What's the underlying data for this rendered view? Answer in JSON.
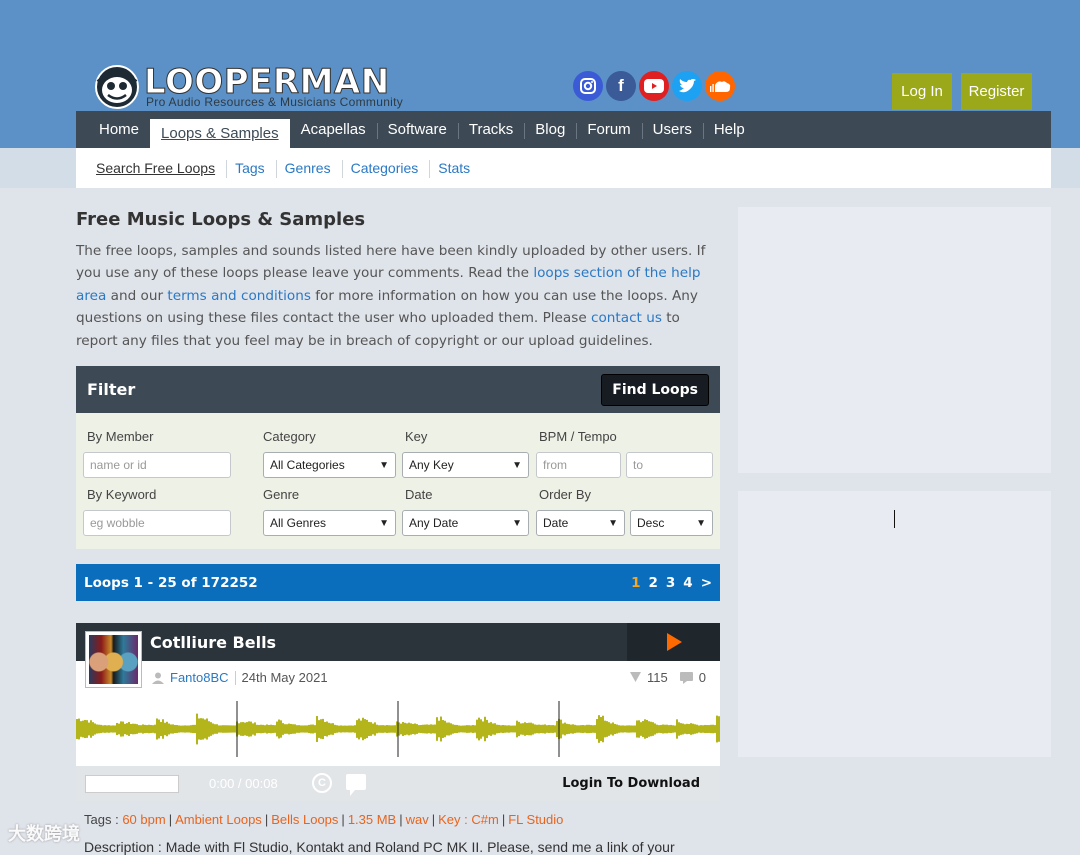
{
  "header": {
    "logo_text": "LOOPERMAN",
    "logo_sub": "Pro Audio Resources & Musicians Community",
    "login_label": "Log In",
    "register_label": "Register",
    "socials": [
      "instagram-icon",
      "facebook-icon",
      "youtube-icon",
      "twitter-icon",
      "soundcloud-icon"
    ]
  },
  "nav": {
    "items": [
      "Home",
      "Loops & Samples",
      "Acapellas",
      "Software",
      "Tracks",
      "Blog",
      "Forum",
      "Users",
      "Help"
    ],
    "active": "Loops & Samples"
  },
  "subnav": {
    "items": [
      "Search Free Loops",
      "Tags",
      "Genres",
      "Categories",
      "Stats"
    ]
  },
  "intro": {
    "title": "Free Music Loops & Samples",
    "p1": "The free loops, samples and sounds listed here have been kindly uploaded by other users. If you use any of these loops please leave your comments. Read the ",
    "link1": "loops section of the help area",
    "p2": " and our ",
    "link2": "terms and conditions",
    "p3": " for more information on how you can use the loops. Any questions on using these files contact the user who uploaded them. Please ",
    "link3": "contact us",
    "p4": " to report any files that you feel may be in breach of copyright or our upload guidelines."
  },
  "filter": {
    "title": "Filter",
    "find_label": "Find Loops",
    "by_member_label": "By Member",
    "member_placeholder": "name or id",
    "category_label": "Category",
    "category_value": "All Categories",
    "key_label": "Key",
    "key_value": "Any Key",
    "bpm_label": "BPM / Tempo",
    "bpm_from_placeholder": "from",
    "bpm_to_placeholder": "to",
    "keyword_label": "By Keyword",
    "keyword_placeholder": "eg wobble",
    "genre_label": "Genre",
    "genre_value": "All Genres",
    "date_label": "Date",
    "date_value": "Any Date",
    "order_label": "Order By",
    "order_value": "Date",
    "order_dir_value": "Desc"
  },
  "results": {
    "summary": "Loops 1 - 25 of 172252",
    "pages": [
      "1",
      "2",
      "3",
      "4",
      ">"
    ],
    "current_page": "1"
  },
  "loop": {
    "title": "Cotlliure Bells",
    "user": "Fanto8BC",
    "date": "24th May 2021",
    "downloads": "115",
    "comments": "0",
    "time": "0:00 / 00:08",
    "login_download": "Login To Download",
    "tags_label": "Tags :",
    "tags": [
      "60 bpm",
      "Ambient Loops",
      "Bells Loops",
      "1.35 MB",
      "wav",
      "Key : C#m",
      "FL Studio"
    ],
    "description": "Description : Made with Fl Studio, Kontakt and Roland PC MK II. Please, send me a link of your"
  },
  "watermark": "大数跨境",
  "colors": {
    "header_bg": "#5b91c7",
    "nav_bg": "#3d4a55",
    "accent_green": "#9aa81a",
    "results_bar": "#0a6ebd",
    "tag_orange": "#e8641c",
    "wave": "#b3b51a"
  }
}
